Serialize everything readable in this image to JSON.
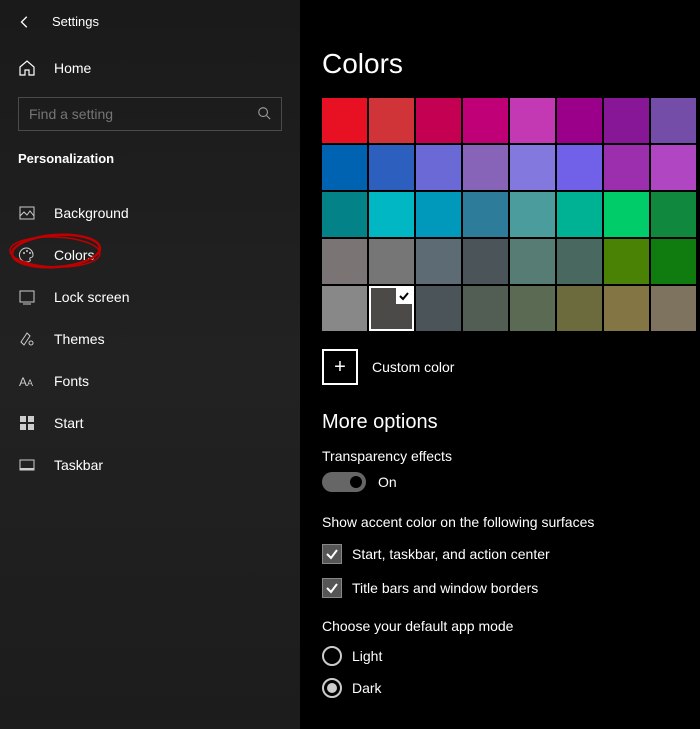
{
  "header": {
    "title": "Settings"
  },
  "sidebar": {
    "home_label": "Home",
    "search_placeholder": "Find a setting",
    "section": "Personalization",
    "items": [
      {
        "label": "Background"
      },
      {
        "label": "Colors"
      },
      {
        "label": "Lock screen"
      },
      {
        "label": "Themes"
      },
      {
        "label": "Fonts"
      },
      {
        "label": "Start"
      },
      {
        "label": "Taskbar"
      }
    ]
  },
  "main": {
    "title": "Colors",
    "swatches": [
      [
        "#e81123",
        "#d13438",
        "#c30052",
        "#bf0077",
        "#c239b3",
        "#9a0089",
        "#881798",
        "#744da9"
      ],
      [
        "#0063b1",
        "#2d5fbf",
        "#6b69d6",
        "#8764b8",
        "#8378de",
        "#7160e8",
        "#9b2fae",
        "#b146c2"
      ],
      [
        "#038387",
        "#00b7c3",
        "#0099bc",
        "#2d7d9a",
        "#4a9d9c",
        "#00b294",
        "#00cc6a",
        "#10893e"
      ],
      [
        "#7a7574",
        "#767676",
        "#5d6b75",
        "#4a5459",
        "#567c73",
        "#486860",
        "#498205",
        "#107c10"
      ],
      [
        "#888888",
        "#4c4a48",
        "#4a5459",
        "#525e54",
        "#5b6a53",
        "#6b6b3e",
        "#847545",
        "#7e735f"
      ]
    ],
    "selected": {
      "row": 4,
      "col": 1
    },
    "custom_label": "Custom color",
    "more_heading": "More options",
    "transparency": {
      "label": "Transparency effects",
      "state": "On"
    },
    "accent_heading": "Show accent color on the following surfaces",
    "checks": [
      {
        "label": "Start, taskbar, and action center",
        "checked": true
      },
      {
        "label": "Title bars and window borders",
        "checked": true
      }
    ],
    "mode_heading": "Choose your default app mode",
    "modes": [
      {
        "label": "Light",
        "selected": false
      },
      {
        "label": "Dark",
        "selected": true
      }
    ],
    "annotation": {
      "circled_item": "Colors",
      "color": "#c00000"
    }
  }
}
